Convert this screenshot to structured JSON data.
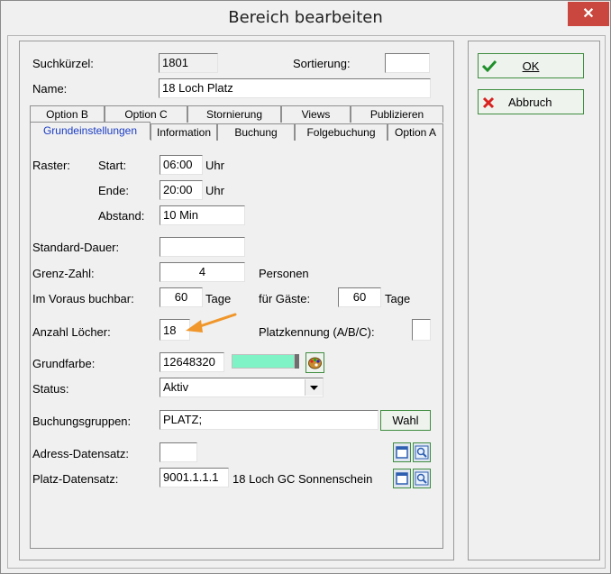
{
  "window": {
    "title": "Bereich bearbeiten",
    "close_glyph": "✕"
  },
  "header": {
    "suchkuerzel_label": "Suchkürzel:",
    "suchkuerzel_value": "1801",
    "sortierung_label": "Sortierung:",
    "sortierung_value": "",
    "name_label": "Name:",
    "name_value": "18 Loch Platz"
  },
  "tabs": {
    "back_row": [
      "Option B",
      "Option C",
      "Stornierung",
      "Views",
      "Publizieren"
    ],
    "front_row": [
      "Grundeinstellungen",
      "Information",
      "Buchung",
      "Folgebuchung",
      "Option A"
    ],
    "active": "Grundeinstellungen"
  },
  "form": {
    "raster_label": "Raster:",
    "start_label": "Start:",
    "start_value": "06:00",
    "start_unit": "Uhr",
    "ende_label": "Ende:",
    "ende_value": "20:00",
    "ende_unit": "Uhr",
    "abstand_label": "Abstand:",
    "abstand_value": "10 Min",
    "standard_dauer_label": "Standard-Dauer:",
    "standard_dauer_value": "",
    "grenz_zahl_label": "Grenz-Zahl:",
    "grenz_zahl_value": "4",
    "grenz_zahl_unit": "Personen",
    "voraus_label": "Im Voraus buchbar:",
    "voraus_value": "60",
    "voraus_unit": "Tage",
    "gaeste_label": "für Gäste:",
    "gaeste_value": "60",
    "gaeste_unit": "Tage",
    "loecher_label": "Anzahl Löcher:",
    "loecher_value": "18",
    "platzkennung_label": "Platzkennung (A/B/C):",
    "platzkennung_value": "",
    "grundfarbe_label": "Grundfarbe:",
    "grundfarbe_value": "12648320",
    "grundfarbe_color": "#7ff3c5",
    "status_label": "Status:",
    "status_value": "Aktiv",
    "buchungsgruppen_label": "Buchungsgruppen:",
    "buchungsgruppen_value": "PLATZ;",
    "wahl_label": "Wahl",
    "adress_label": "Adress-Datensatz:",
    "adress_value": "",
    "platz_label": "Platz-Datensatz:",
    "platz_value": "9001.1.1.1",
    "platz_text": "18 Loch GC Sonnenschein"
  },
  "actions": {
    "ok_label": "OK",
    "abbruch_label": "Abbruch"
  },
  "colors": {
    "accent_tab": "#1a3cc4",
    "close_bg": "#c9473e",
    "arrow": "#f0962a"
  }
}
